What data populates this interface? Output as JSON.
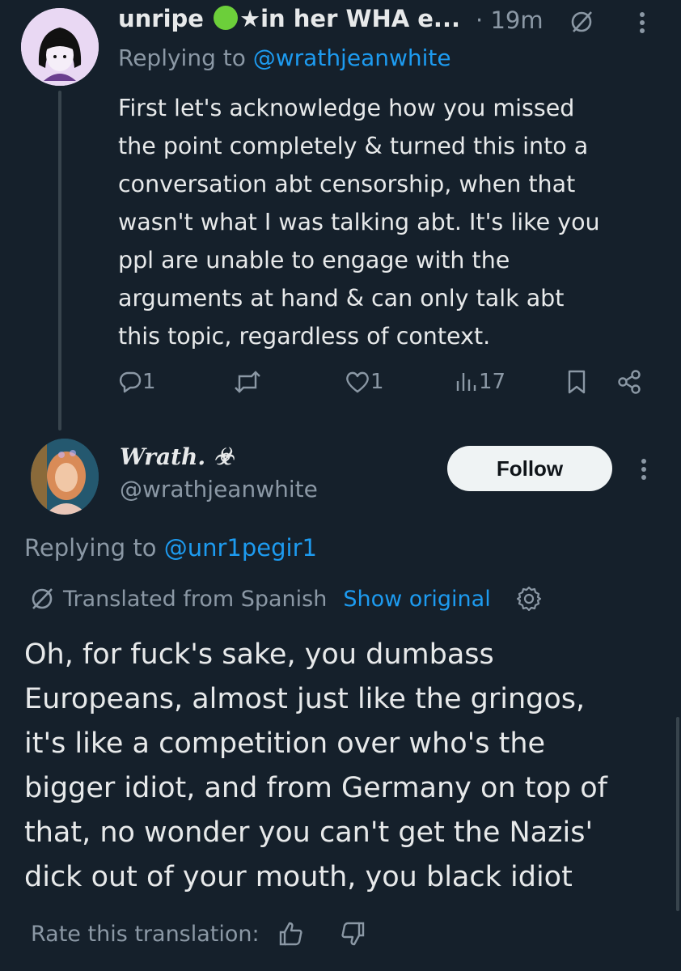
{
  "reply1": {
    "display_name_prefix": "unripe",
    "display_name_suffix": "★in her WHA e...",
    "separator": "·",
    "time": "19m",
    "replying_prefix": "Replying to",
    "replying_handle": "@wrathjeanwhite",
    "body_lines": [
      "First let's acknowledge how you missed",
      "the point completely & turned this into a",
      "conversation abt censorship, when that",
      "wasn't what I was talking abt. It's like you",
      "ppl are unable to engage with the",
      "arguments at hand & can only talk abt",
      "this topic, regardless of context."
    ],
    "actions": {
      "replies": "1",
      "likes": "1",
      "views": "17"
    }
  },
  "tweet2": {
    "display_name": "Wrath. ☣",
    "handle": "@wrathjeanwhite",
    "follow_label": "Follow",
    "replying_prefix": "Replying to",
    "replying_handle": "@unr1pegir1",
    "translated_label": "Translated from Spanish",
    "show_original_label": "Show original",
    "body_lines": [
      "Oh, for fuck's sake, you dumbass",
      "Europeans, almost just like the gringos,",
      "it's like a competition over who's the",
      "bigger idiot, and from Germany on top of",
      "that, no wonder you can't get the Nazis'",
      "dick out of your mouth, you black idiot"
    ],
    "rate_label": "Rate this translation:"
  },
  "colors": {
    "background": "#15202b",
    "primary_text": "#e7e9ea",
    "secondary_text": "#8b98a5",
    "link": "#1d9bf0",
    "follow_button": "#eff3f4"
  },
  "icons": {
    "grok": "translate-slash-icon",
    "more": "more-vertical-icon",
    "reply": "reply-icon",
    "retweet": "retweet-icon",
    "like": "heart-icon",
    "views": "views-icon",
    "bookmark": "bookmark-icon",
    "share": "share-icon",
    "settings": "gear-icon",
    "thumbs_up": "thumbs-up-icon",
    "thumbs_down": "thumbs-down-icon"
  }
}
